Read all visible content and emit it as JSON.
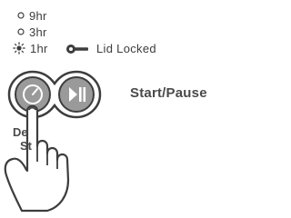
{
  "timers": [
    {
      "label": "9hr",
      "icon": "circle-outline-icon"
    },
    {
      "label": "3hr",
      "icon": "circle-outline-icon"
    },
    {
      "label": "1hr",
      "icon": "sun-indicator-icon"
    }
  ],
  "lid": {
    "label": "Lid Locked",
    "icon": "key-icon"
  },
  "start": {
    "label": "Start/Pause"
  },
  "delay": {
    "line1": "De",
    "line2": "St"
  },
  "colors": {
    "stroke": "#3d3d3d",
    "button_fill": "#9a9a9a",
    "text": "#4a4a4a"
  }
}
